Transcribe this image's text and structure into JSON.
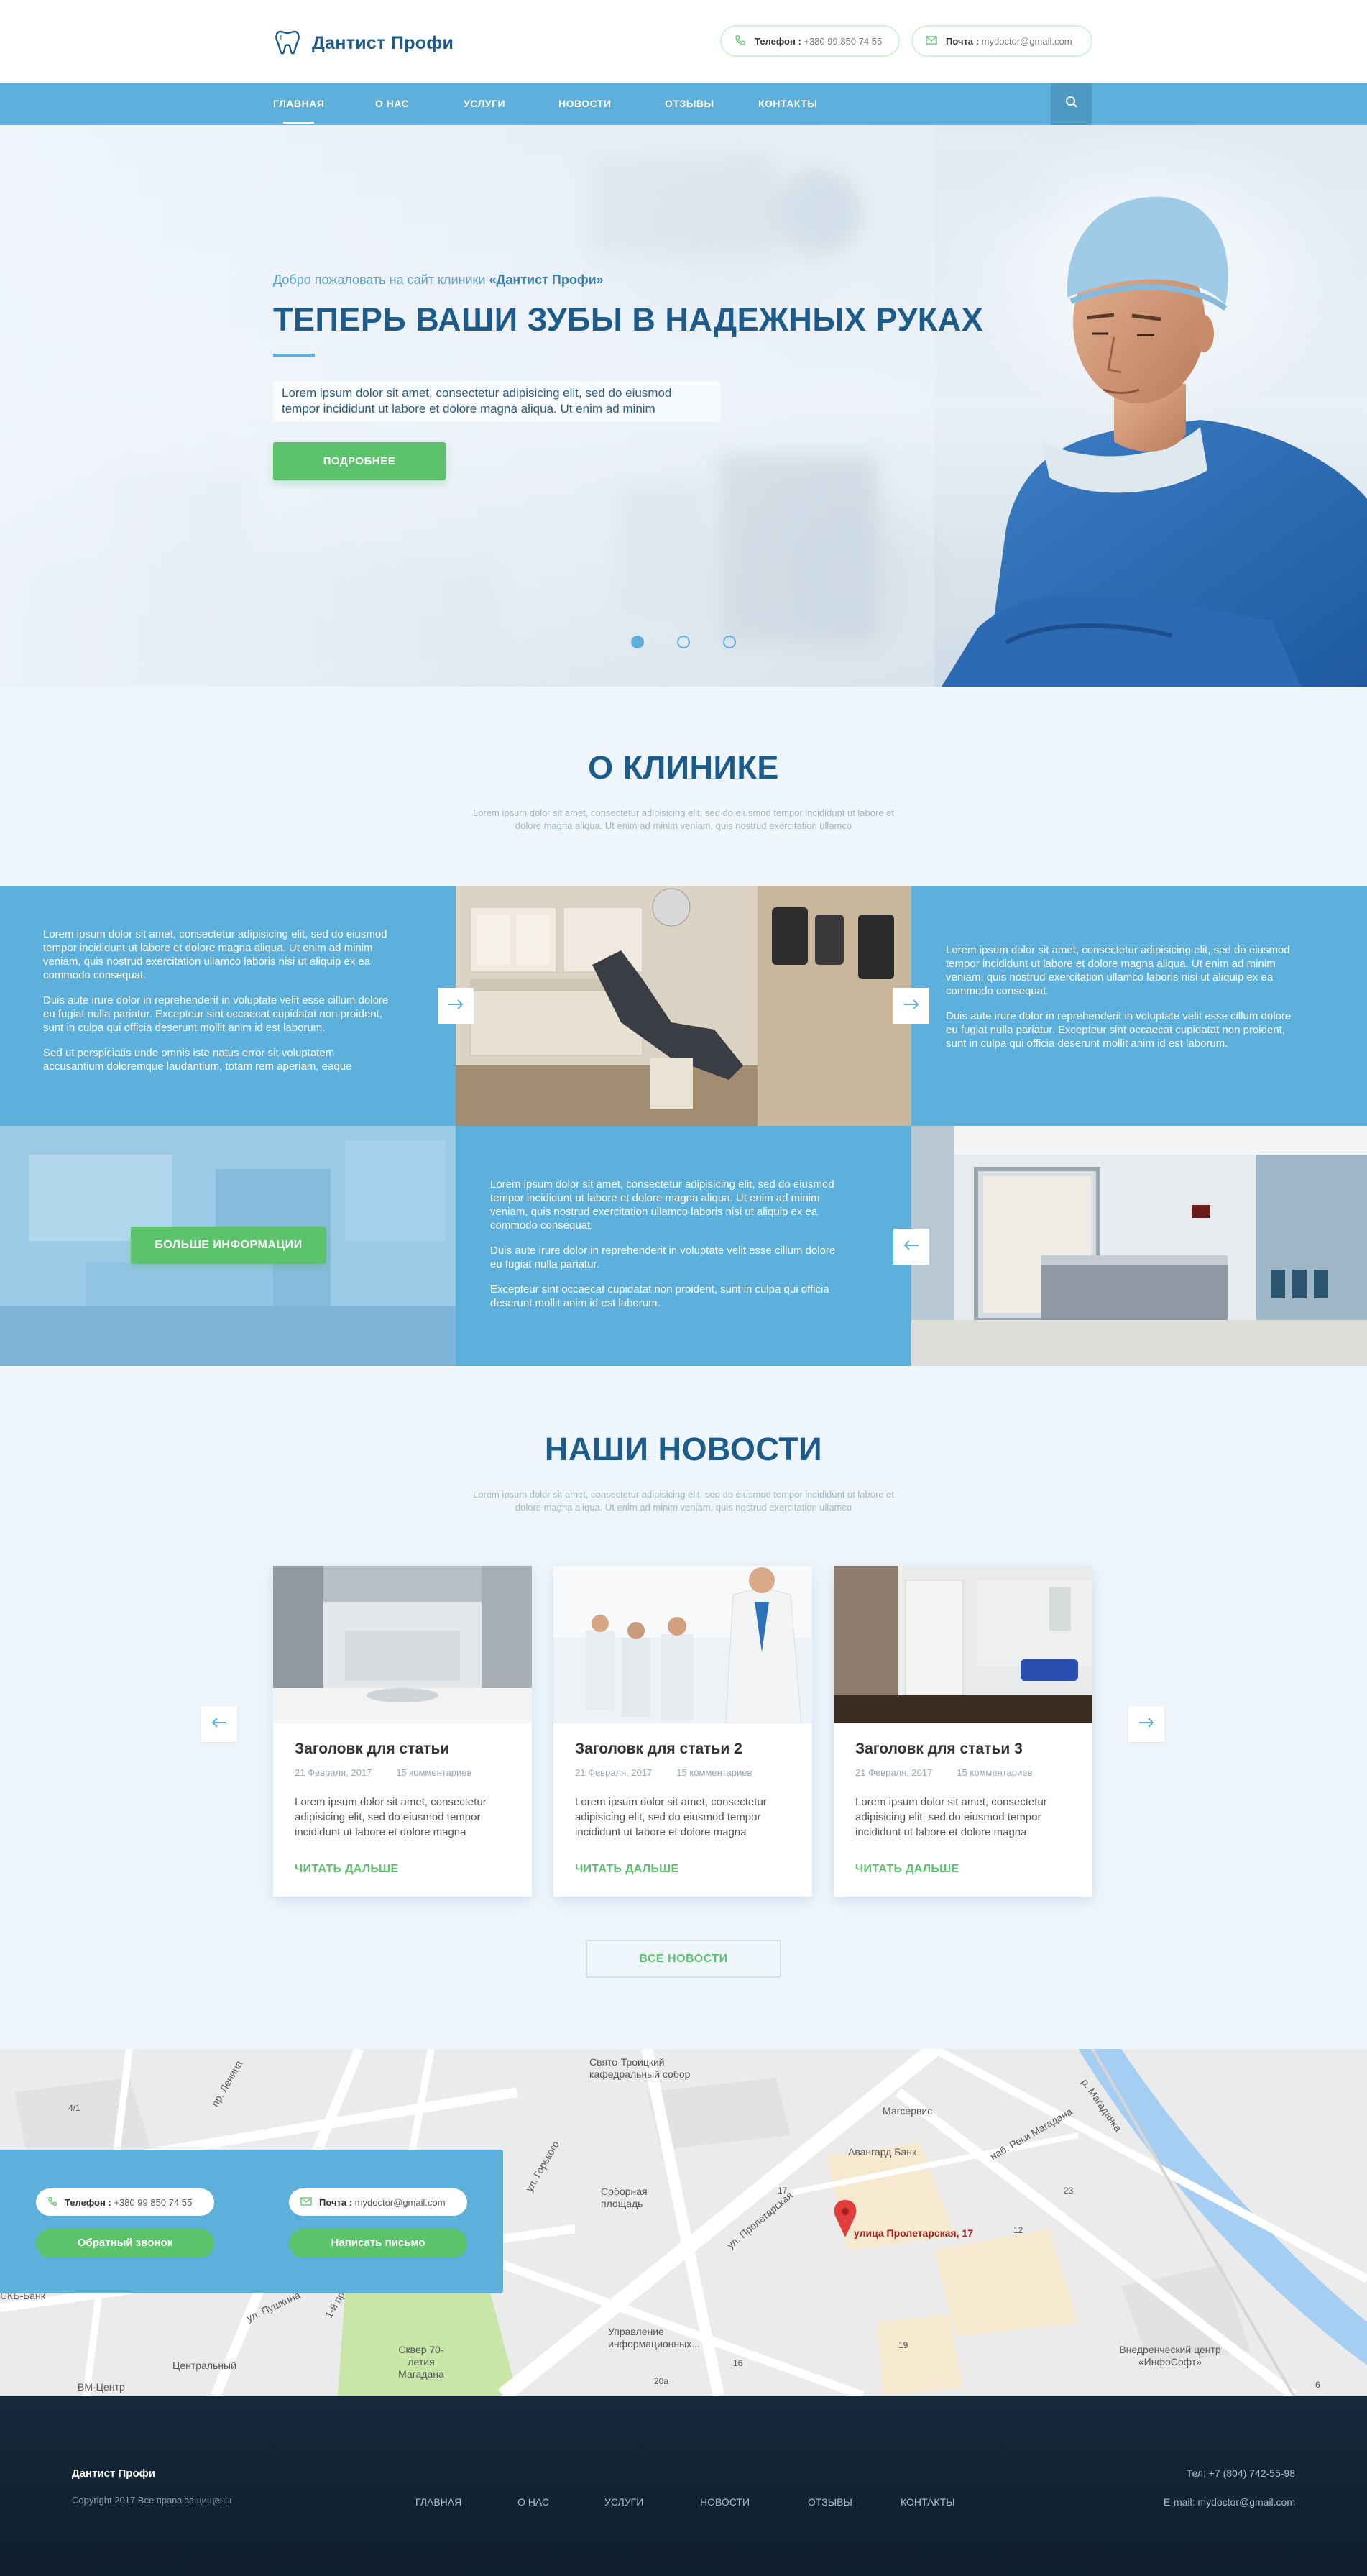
{
  "brand": {
    "name": "Дантист Профи",
    "accent": "#5eb0dc",
    "green": "#5cc26c",
    "dark_blue": "#1d5b8a"
  },
  "header": {
    "phone_label": "Телефон :",
    "phone_value": "+380 99 850 74 55",
    "mail_label": "Почта :",
    "mail_value": "mydoctor@gmail.com"
  },
  "nav": {
    "items": [
      "ГЛАВНАЯ",
      "О НАС",
      "УСЛУГИ",
      "НОВОСТИ",
      "ОТЗЫВЫ",
      "КОНТАКТЫ"
    ],
    "active_index": 0,
    "search_icon": "search-icon"
  },
  "hero": {
    "welcome_prefix": "Добро пожаловать на сайт клиники ",
    "welcome_brand": "«Дантист Профи»",
    "title": "ТЕПЕРЬ ВАШИ ЗУБЫ В НАДЕЖНЫХ РУКАХ",
    "text": "Lorem ipsum dolor sit amet, consectetur adipisicing elit, sed do eiusmod tempor incididunt ut labore et dolore magna aliqua. Ut enim ad minim",
    "button": "ПОДРОБНЕЕ",
    "slides_count": 3,
    "active_slide": 1
  },
  "about": {
    "title": "О КЛИНИКЕ",
    "subtitle": "Lorem ipsum dolor sit amet, consectetur adipisicing elit, sed do eiusmod tempor incididunt ut labore et dolore magna aliqua. Ut enim ad minim veniam, quis nostrud exercitation ullamco",
    "block1": [
      "Lorem ipsum dolor sit amet, consectetur adipisicing elit, sed do eiusmod tempor incididunt ut labore et dolore magna aliqua. Ut enim ad minim veniam, quis nostrud exercitation ullamco laboris nisi ut aliquip ex ea commodo consequat.",
      "Duis aute irure dolor in reprehenderit in voluptate velit esse cillum dolore eu fugiat nulla pariatur. Excepteur sint occaecat cupidatat non proident, sunt in culpa qui officia deserunt mollit anim id est laborum.",
      "Sed ut perspiciatis unde omnis iste natus error sit voluptatem accusantium doloremque laudantium, totam rem aperiam, eaque"
    ],
    "block2": [
      "Lorem ipsum dolor sit amet, consectetur adipisicing elit, sed do eiusmod tempor incididunt ut labore et dolore magna aliqua. Ut enim ad minim veniam, quis nostrud exercitation ullamco laboris nisi ut aliquip ex ea commodo consequat.",
      "Duis aute irure dolor in reprehenderit in voluptate velit esse cillum dolore eu fugiat nulla pariatur. Excepteur sint occaecat cupidatat non proident, sunt in culpa qui officia deserunt mollit anim id est laborum."
    ],
    "block3": [
      "Lorem ipsum dolor sit amet, consectetur adipisicing elit, sed do eiusmod tempor incididunt ut labore et dolore magna aliqua. Ut enim ad minim veniam, quis nostrud exercitation ullamco laboris nisi ut aliquip ex ea commodo consequat.",
      "Duis aute irure dolor in reprehenderit in voluptate velit esse cillum dolore eu fugiat nulla pariatur.",
      "Excepteur sint occaecat cupidatat non proident, sunt in culpa qui officia deserunt mollit anim id est laborum."
    ],
    "more_button": "БОЛЬШЕ ИНФОРМАЦИИ"
  },
  "news": {
    "title": "НАШИ НОВОСТИ",
    "subtitle": "Lorem ipsum dolor sit amet, consectetur adipisicing elit, sed do eiusmod tempor incididunt ut labore et dolore magna aliqua. Ut enim ad minim veniam, quis nostrud exercitation ullamco",
    "cards": [
      {
        "title": "Заголовк для статьи",
        "date": "21 Февраля, 2017",
        "comments": "15 комментариев",
        "text": "Lorem ipsum dolor sit amet, consectetur adipisicing elit, sed do eiusmod tempor incididunt ut labore et dolore magna",
        "link": "ЧИТАТЬ ДАЛЬШЕ"
      },
      {
        "title": "Заголовк для статьи 2",
        "date": "21 Февраля, 2017",
        "comments": "15 комментариев",
        "text": "Lorem ipsum dolor sit amet, consectetur adipisicing elit, sed do eiusmod tempor incididunt ut labore et dolore magna",
        "link": "ЧИТАТЬ ДАЛЬШЕ"
      },
      {
        "title": "Заголовк для статьи 3",
        "date": "21 Февраля, 2017",
        "comments": "15 комментариев",
        "text": "Lorem ipsum dolor sit amet, consectetur adipisicing elit, sed do eiusmod tempor incididunt ut labore et dolore magna",
        "link": "ЧИТАТЬ ДАЛЬШЕ"
      }
    ],
    "all_button": "ВСЕ НОВОСТИ"
  },
  "map": {
    "marker_label": "улица Пролетарская, 17",
    "labels": [
      "Свято-Троицкий кафедральный собор",
      "Магсервис",
      "Авангард Банк",
      "Соборная площадь",
      "ул. Пролетарская",
      "ул. Горького",
      "пр. Ленина",
      "наб. Реки Магадана",
      "р. Магаданка",
      "Управление информационных...",
      "Сквер 70-летия Магадана",
      "Центральный",
      "ВМ-Центр",
      "СКБ-Банк",
      "Внедренческий центр «ИнфоСофт»",
      "ул. Пушкина",
      "1-й пр. Горького",
      "4/1",
      "17",
      "19",
      "12",
      "20а",
      "16",
      "23",
      "6"
    ],
    "phone_label": "Телефон :",
    "phone_value": "+380 99 850 74 55",
    "mail_label": "Почта :",
    "mail_value": "mydoctor@gmail.com",
    "callback_button": "Обратный звонок",
    "write_button": "Написать письмо"
  },
  "footer": {
    "brand": "Дантист Профи",
    "copyright": "Copyright 2017 Все права защищены",
    "nav": [
      "ГЛАВНАЯ",
      "О НАС",
      "УСЛУГИ",
      "НОВОСТИ",
      "ОТЗЫВЫ",
      "КОНТАКТЫ"
    ],
    "phone": "Тел: +7 (804) 742-55-98",
    "email": "E-mail: mydoctor@gmail.com"
  }
}
